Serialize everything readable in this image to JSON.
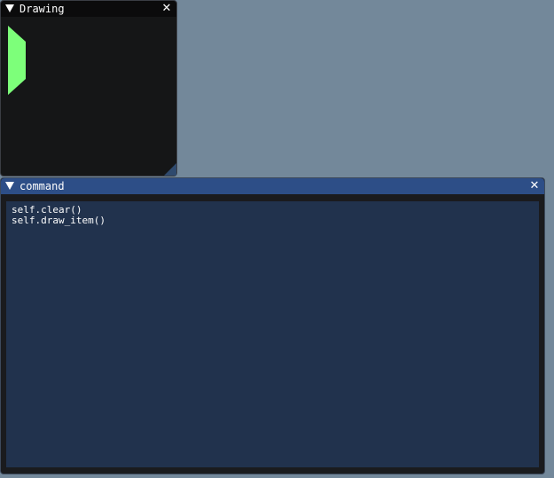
{
  "windows": {
    "drawing": {
      "title": "Drawing",
      "close_glyph": "✕",
      "shape_color": "#7dff7a"
    },
    "command": {
      "title": "command",
      "close_glyph": "✕",
      "lines": [
        "self.clear()",
        "self.draw_item()"
      ]
    }
  },
  "colors": {
    "background": "#73889a",
    "drawing_body": "#151617",
    "command_titlebar": "#2d4e87",
    "command_textarea": "#21324d"
  }
}
